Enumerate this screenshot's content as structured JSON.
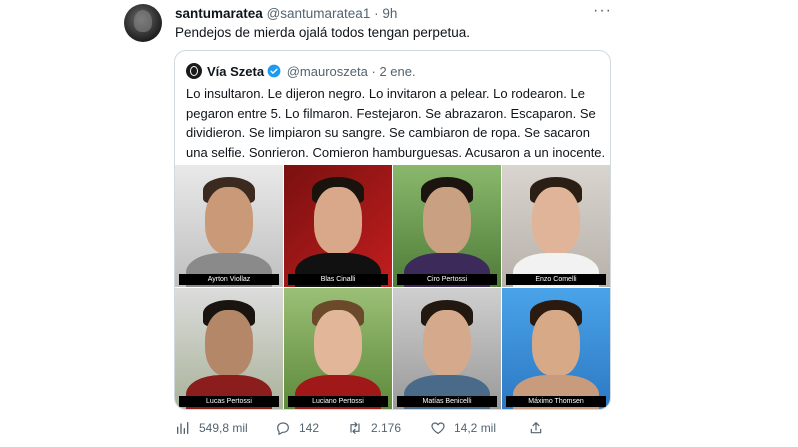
{
  "tweet": {
    "author_name": "santumaratea",
    "author_handle": "@santumaratea1",
    "dot": "·",
    "time": "9h",
    "more": "···",
    "text": "Pendejos de mierda ojalá todos tengan perpetua."
  },
  "quote": {
    "author_name": "Vía Szeta",
    "author_handle": "@mauroszeta",
    "dot": "·",
    "time": "2 ene.",
    "text": "Lo insultaron. Le dijeron negro. Lo invitaron a pelear. Lo rodearon. Le pegaron entre 5. Lo filmaron. Festejaron. Se abrazaron. Escaparon. Se dividieron. Se limpiaron su sangre. Se cambiaron de ropa. Se sacaron una selfie. Sonrieron. Comieron hamburguesas. Acusaron a un inocente.",
    "photos": [
      {
        "caption": "Ayrton Viollaz"
      },
      {
        "caption": "Blas Cinalli"
      },
      {
        "caption": "Ciro Pertossi"
      },
      {
        "caption": "Enzo Comelli"
      },
      {
        "caption": "Lucas Pertossi"
      },
      {
        "caption": "Luciano Pertossi"
      },
      {
        "caption": "Matías Benicelli"
      },
      {
        "caption": "Máximo Thomsen"
      }
    ]
  },
  "actions": {
    "views": "549,8 mil",
    "replies": "142",
    "retweets": "2.176",
    "likes": "14,2 mil"
  },
  "colors": {
    "text": "#0f1419",
    "secondary": "#536471",
    "border": "#cfd9de",
    "verified": "#1d9bf0"
  }
}
